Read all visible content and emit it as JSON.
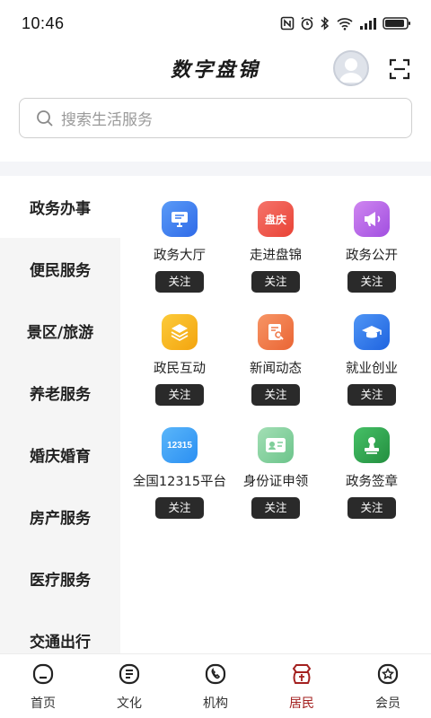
{
  "status_bar": {
    "time": "10:46"
  },
  "header": {
    "title": "数字盘锦"
  },
  "search": {
    "placeholder": "搜索生活服务"
  },
  "sidebar": {
    "items": [
      {
        "label": "政务办事",
        "active": true
      },
      {
        "label": "便民服务"
      },
      {
        "label": "景区/旅游"
      },
      {
        "label": "养老服务"
      },
      {
        "label": "婚庆婚育"
      },
      {
        "label": "房产服务"
      },
      {
        "label": "医疗服务"
      },
      {
        "label": "交通出行"
      }
    ]
  },
  "services": [
    {
      "label": "政务大厅",
      "follow": "关注",
      "icon": "monitor-icon",
      "color": "#3a7bf0"
    },
    {
      "label": "走进盘锦",
      "follow": "关注",
      "icon": "panjin-logo-icon",
      "icon_text": "盘庆",
      "color": "#f0584a"
    },
    {
      "label": "政务公开",
      "follow": "关注",
      "icon": "megaphone-icon",
      "color": "#b764e6"
    },
    {
      "label": "政民互动",
      "follow": "关注",
      "icon": "layers-icon",
      "color": "#f6b820"
    },
    {
      "label": "新闻动态",
      "follow": "关注",
      "icon": "news-search-icon",
      "color": "#f07a4a"
    },
    {
      "label": "就业创业",
      "follow": "关注",
      "icon": "graduation-cap-icon",
      "color": "#2e7ef0"
    },
    {
      "label": "全国12315平台",
      "follow": "关注",
      "icon": "12315-icon",
      "icon_text": "12315",
      "color": "#3aa0f5"
    },
    {
      "label": "身份证申领",
      "follow": "关注",
      "icon": "id-card-icon",
      "color": "#7fce9a"
    },
    {
      "label": "政务签章",
      "follow": "关注",
      "icon": "stamp-icon",
      "color": "#2fa84f"
    }
  ],
  "bottom_nav": {
    "items": [
      {
        "label": "首页",
        "icon": "home-icon"
      },
      {
        "label": "文化",
        "icon": "culture-icon"
      },
      {
        "label": "机构",
        "icon": "phone-icon"
      },
      {
        "label": "居民",
        "icon": "resident-icon",
        "active": true
      },
      {
        "label": "会员",
        "icon": "member-icon"
      }
    ]
  },
  "colors": {
    "accent": "#a3201f",
    "follow_bg": "#2a2a2a",
    "sidebar_bg": "#f5f5f5"
  }
}
